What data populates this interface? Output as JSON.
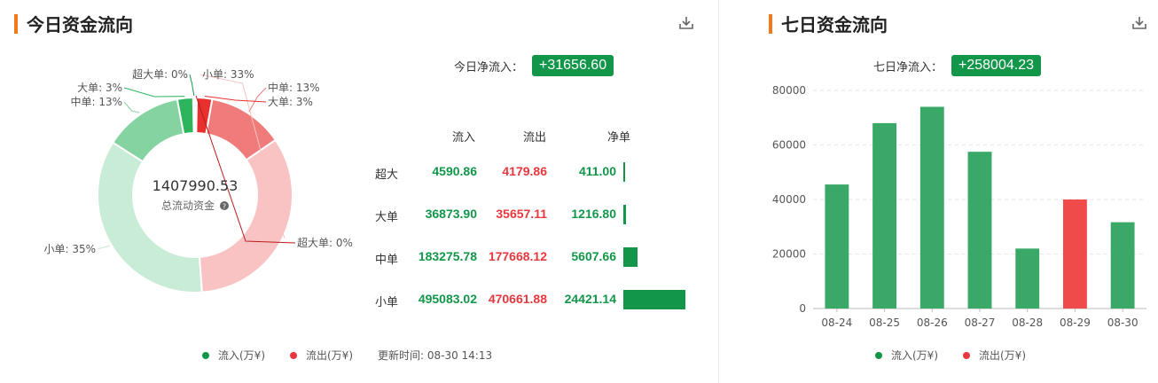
{
  "today": {
    "title": "今日资金流向",
    "net_label": "今日净流入：",
    "net_value": "+31656.60",
    "center_value": "1407990.53",
    "center_label": "总流动资金",
    "columns": [
      "流入",
      "流出",
      "净单"
    ],
    "rows": [
      {
        "label": "超大",
        "in": "4590.86",
        "out": "4179.86",
        "net": "411.00",
        "net_num": 411.0
      },
      {
        "label": "大单",
        "in": "36873.90",
        "out": "35657.11",
        "net": "1216.80",
        "net_num": 1216.8
      },
      {
        "label": "中单",
        "in": "183275.78",
        "out": "177668.12",
        "net": "5607.66",
        "net_num": 5607.66
      },
      {
        "label": "小单",
        "in": "495083.02",
        "out": "470661.88",
        "net": "24421.14",
        "net_num": 24421.14
      }
    ],
    "legend_in": "流入(万¥)",
    "legend_out": "流出(万¥)",
    "update_time": "更新时间: 08-30 14:13"
  },
  "week": {
    "title": "七日资金流向",
    "net_label": "七日净流入：",
    "net_value": "+258004.23",
    "legend_in": "流入(万¥)",
    "legend_out": "流出(万¥)"
  },
  "colors": {
    "inflow": "#3aa866",
    "outflow": "#ef4b4b",
    "accent": "#f07a1a",
    "badge": "#12964a"
  },
  "chart_data": [
    {
      "type": "pie",
      "subtype": "donut",
      "slices": [
        {
          "label": "超大单: 0%",
          "value": 4590.86,
          "direction": "in",
          "color": "#1a9850"
        },
        {
          "label": "大单: 3%",
          "value": 36873.9,
          "direction": "in",
          "color": "#2db55d"
        },
        {
          "label": "中单: 13%",
          "value": 183275.78,
          "direction": "in",
          "color": "#85d3a1"
        },
        {
          "label": "小单: 35%",
          "value": 495083.02,
          "direction": "in",
          "color": "#c8ecd6"
        },
        {
          "label": "小单: 33%",
          "value": 470661.88,
          "direction": "out",
          "color": "#f9c3c3"
        },
        {
          "label": "中单: 13%",
          "value": 177668.12,
          "direction": "out",
          "color": "#f07b7b"
        },
        {
          "label": "大单: 3%",
          "value": 35657.11,
          "direction": "out",
          "color": "#e8302f"
        },
        {
          "label": "超大单: 0%",
          "value": 4179.86,
          "direction": "out",
          "color": "#b81d1d"
        }
      ]
    },
    {
      "type": "bar",
      "categories": [
        "08-24",
        "08-25",
        "08-26",
        "08-27",
        "08-28",
        "08-29",
        "08-30"
      ],
      "values": [
        45500,
        68000,
        74000,
        57500,
        22000,
        40000,
        31656.6
      ],
      "direction": [
        "in",
        "in",
        "in",
        "in",
        "in",
        "out",
        "in"
      ],
      "yticks": [
        0,
        20000,
        40000,
        60000,
        80000
      ],
      "ylim": [
        0,
        80000
      ],
      "grid": true
    }
  ]
}
